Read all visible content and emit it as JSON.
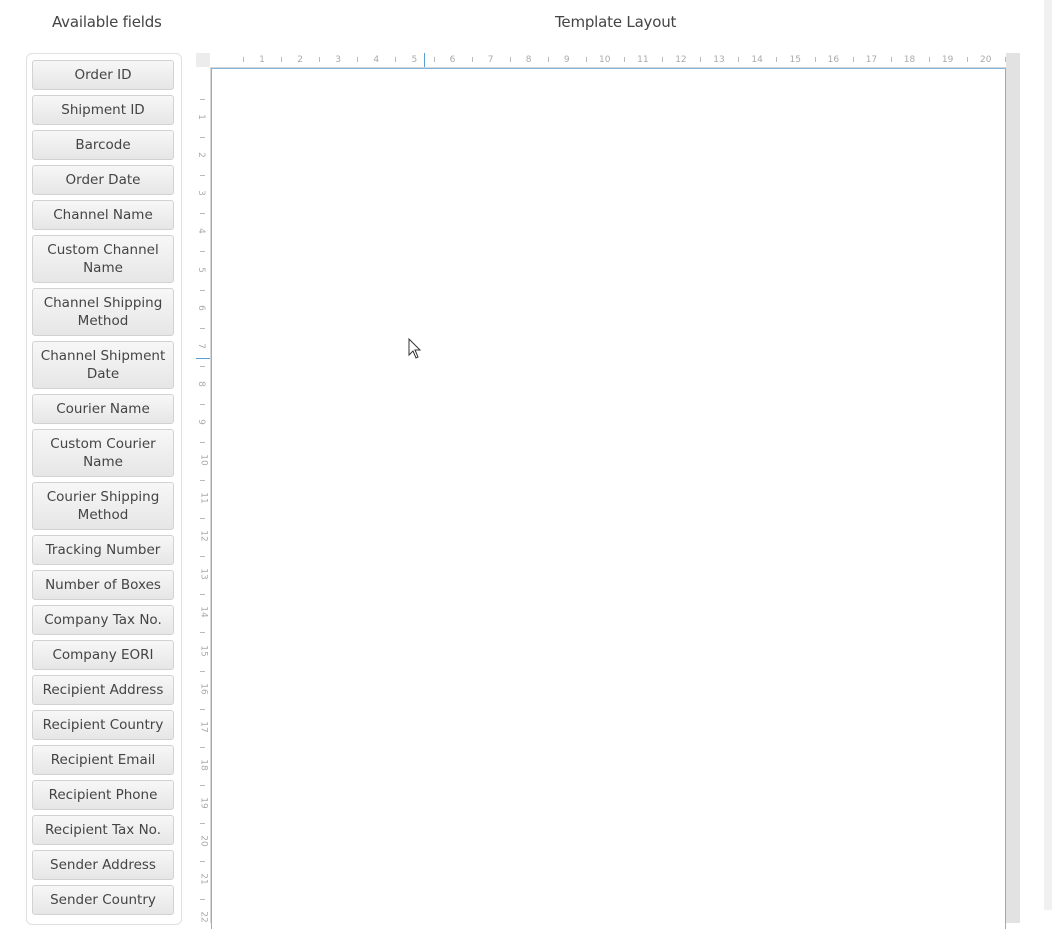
{
  "headings": {
    "available_fields": "Available fields",
    "template_layout": "Template Layout"
  },
  "fields": [
    "Order ID",
    "Shipment ID",
    "Barcode",
    "Order Date",
    "Channel Name",
    "Custom Channel Name",
    "Channel Shipping Method",
    "Channel Shipment Date",
    "Courier Name",
    "Custom Courier Name",
    "Courier Shipping Method",
    "Tracking Number",
    "Number of Boxes",
    "Company Tax No.",
    "Company EORI",
    "Recipient Address",
    "Recipient Country",
    "Recipient Email",
    "Recipient Phone",
    "Recipient Tax No.",
    "Sender Address",
    "Sender Country"
  ],
  "ruler": {
    "top_numbers": [
      "1",
      "2",
      "3",
      "4",
      "5",
      "6",
      "7",
      "8",
      "9",
      "10",
      "11",
      "12",
      "13",
      "14",
      "15",
      "16",
      "17",
      "18",
      "19",
      "20"
    ],
    "left_numbers": [
      "1",
      "2",
      "3",
      "4",
      "5",
      "6",
      "7",
      "8",
      "9",
      "10",
      "11",
      "12",
      "13",
      "14",
      "15",
      "16",
      "17",
      "18",
      "19",
      "20",
      "21",
      "22"
    ]
  },
  "colors": {
    "page_border": "#7fb5dd",
    "ruler_cursor": "#5a9fd4"
  }
}
